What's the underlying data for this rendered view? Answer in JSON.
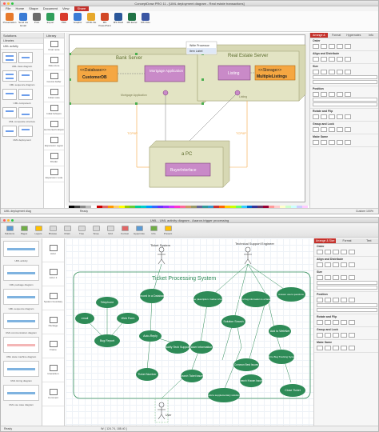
{
  "top": {
    "title": "ConceptDraw PRO 11 - [UML deployment diagram - Real estate transactions]",
    "ribbon_tabs": [
      "File",
      "Home",
      "Shape",
      "Document",
      "View",
      "Share"
    ],
    "active_tab": "Share",
    "ribbon_buttons": [
      "Presentation",
      "Send via Email",
      "Print",
      "Export",
      "PDF",
      "Graphic",
      "HTML file",
      "MS PowerPoint",
      "MS Word",
      "MS Excel",
      "MS Visio"
    ],
    "left_tabs": [
      "Solutions",
      "Library"
    ],
    "lib_header": "Libraries",
    "lib_item": "UML activity",
    "lib_sections": [
      "UML class diagram",
      "UML sequence diagram",
      "UML component",
      "UML composite structure",
      "UML deployment"
    ],
    "tools": [
      "Final node",
      "Data store",
      "Control buffer",
      "Initial node",
      "Initial fork/join",
      "Horizontal fork/join",
      "Expansion region",
      "Divider",
      "Expansion node"
    ],
    "canvas": {
      "bank_server": "Bank Server",
      "database": "<<Database>>",
      "customerdb": "CustomerDB",
      "mortgage": "Mortgage Application",
      "mortgage_iface": "Mortgage Application",
      "real_estate": "Real Estate Server",
      "storage": "<<Storage>>",
      "listing": "Listing",
      "multiple": "MultipleListings",
      "listing_iface": "Listing",
      "pc": "a PC",
      "buyer": "BuyerInterface",
      "tcp_left": "TCP/IP",
      "tcp_right": "TCP/IP",
      "menu_1": "Write Processor",
      "menu_2": "Item Label"
    },
    "right_tabs": [
      "Arrange & Size",
      "Format",
      "Hypernotes",
      "Info"
    ],
    "right_sections": [
      "Order",
      "Align and Distribute",
      "Size",
      "Position",
      "Rotate and Flip",
      "Group and Lock",
      "Make Same"
    ],
    "size_label": "Lock Proportions",
    "status_left": "UML deployment diag",
    "status_mid": "Ready",
    "status_right": "Custom 100%"
  },
  "bottom": {
    "title": "UML - UML activity diagram - Aaaron-trigger processing",
    "toolbar": [
      "Solutions",
      "Pages",
      "Layers",
      "Browse",
      "Chain",
      "Tree",
      "Snap",
      "Grid",
      "Format",
      "Hypernote",
      "Info",
      "Present"
    ],
    "left_items": [
      "UML activity",
      "UML package diagram",
      "UML sequence diagram",
      "UML communication diagram",
      "UML state machine diagram",
      "UML timing diagram",
      "UML use case diagram"
    ],
    "mid_items": [
      "Actor",
      "Actor 2",
      "System boundary",
      "Package",
      "Frame",
      "Interaction",
      "Comment"
    ],
    "canvas": {
      "ticket_system": "Ticket System",
      "tech_engineer": "Technical Support Engineer",
      "boundary": "Ticket Processing System",
      "email": "email",
      "telephone": "Telephone",
      "web_form": "Web Form",
      "bug_report": "Bug Report",
      "record_db": "Record in a Database",
      "auto_reply": "Auto-Reply",
      "notify_tech": "Notify Tech Support",
      "get_value": "Get value (description / Gather information)",
      "record_bug": "Record bug information to a Database",
      "answer_users": "Answer users questions",
      "solution_search": "Solution Search",
      "user_info": "User Information",
      "common_issues": "Common Best Issues",
      "add_to_webnet": "Add to WebNet",
      "ticket_number": "Ticket Number",
      "search_tickets": "Search Ticket Issues",
      "search_known": "Search Known Issues",
      "add_bug": "Add to Bug Tracking System",
      "add_supplementary": "Add a supplementary solution",
      "close_ticket": "Close Ticket",
      "user_label": "User"
    },
    "right_tabs": [
      "Arrange & Size",
      "Format",
      "Text"
    ],
    "right_sections": [
      "Order",
      "Align and Distribute",
      "Size",
      "Position",
      "Rotate and Flip",
      "Group and Lock",
      "Make Same"
    ],
    "status_left": "Ready",
    "status_mid": "W: [ 124.74, 188.40 ]"
  },
  "colors": {
    "accent": "#c4312b",
    "node_face": "#e3e4c4",
    "component": "#c98ac8",
    "orange": "#f5a742",
    "ellipse": "#2e8b57"
  }
}
